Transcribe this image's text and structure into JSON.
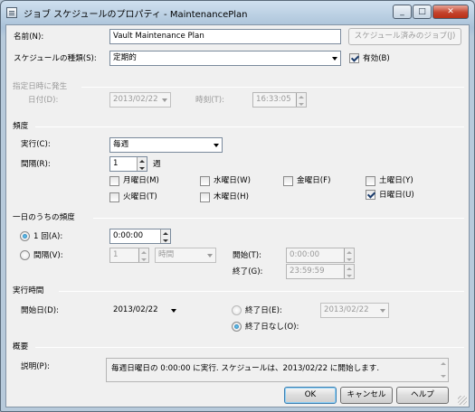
{
  "window": {
    "title": "ジョブ スケジュールのプロパティ - MaintenancePlan",
    "icon": "window-icon"
  },
  "caption_buttons": {
    "minimize": "_",
    "maximize": "□",
    "close": "✕"
  },
  "name": {
    "label": "名前(N):",
    "value": "Vault Maintenance Plan",
    "scheduled_jobs_button": "スケジュール済みのジョブ(J)"
  },
  "schedule_type": {
    "label": "スケジュールの種類(S):",
    "value": "定期的",
    "enabled_label": "有効(B)",
    "enabled": true
  },
  "one_time": {
    "header": "指定日時に発生",
    "date_label": "日付(D):",
    "date_value": "2013/02/22",
    "time_label": "時刻(T):",
    "time_value": "16:33:05"
  },
  "frequency": {
    "header": "頻度",
    "occurs_label": "実行(C):",
    "occurs_value": "毎週",
    "recurs_label": "間隔(R):",
    "recurs_value": "1",
    "recurs_unit": "週",
    "days": [
      {
        "label": "月曜日(M)",
        "checked": false
      },
      {
        "label": "水曜日(W)",
        "checked": false
      },
      {
        "label": "金曜日(F)",
        "checked": false
      },
      {
        "label": "土曜日(Y)",
        "checked": false
      },
      {
        "label": "火曜日(T)",
        "checked": false
      },
      {
        "label": "木曜日(H)",
        "checked": false
      },
      {
        "label": "日曜日(U)",
        "checked": true
      }
    ]
  },
  "daily_frequency": {
    "header": "一日のうちの頻度",
    "once_label": "1 回(A):",
    "once_value": "0:00:00",
    "every_label": "間隔(V):",
    "every_value": "1",
    "every_unit": "時間",
    "start_label": "開始(T):",
    "start_value": "0:00:00",
    "end_label": "終了(G):",
    "end_value": "23:59:59"
  },
  "duration": {
    "header": "実行時間",
    "start_date_label": "開始日(D):",
    "start_date_value": "2013/02/22",
    "end_date_label": "終了日(E):",
    "end_date_value": "2013/02/22",
    "no_end_label": "終了日なし(O):"
  },
  "summary": {
    "header": "概要",
    "description_label": "説明(P):",
    "description_value": "毎週日曜日の 0:00:00 に実行. スケジュールは、2013/02/22 に開始します."
  },
  "buttons": {
    "ok": "OK",
    "cancel": "キャンセル",
    "help": "ヘルプ"
  }
}
